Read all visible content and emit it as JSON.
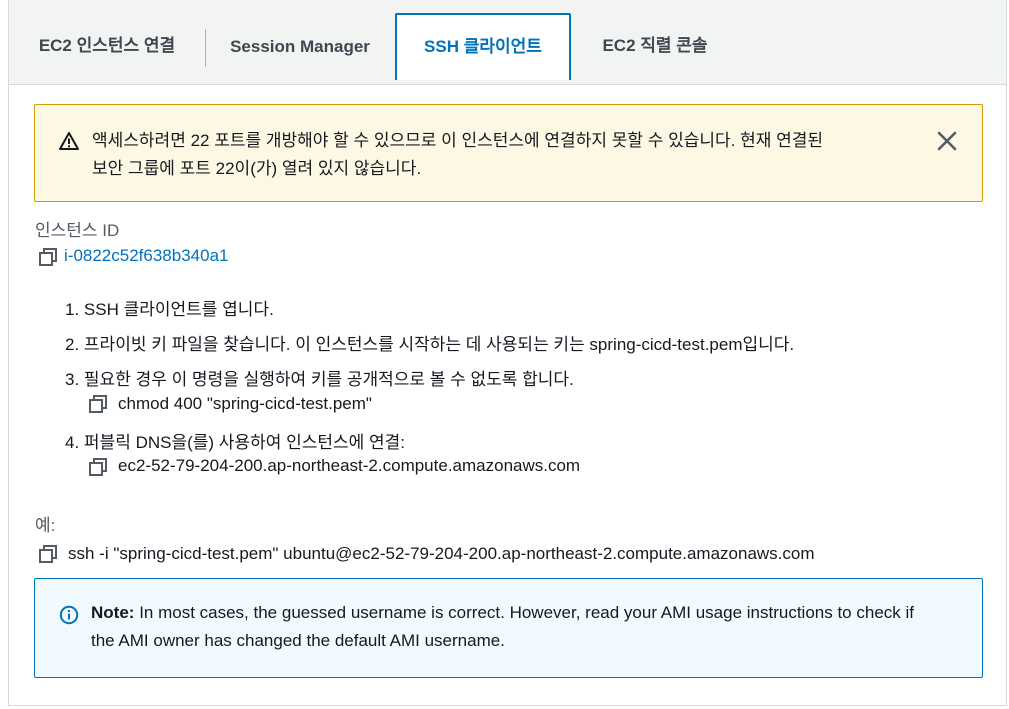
{
  "tabs": [
    {
      "label": "EC2 인스턴스 연결"
    },
    {
      "label": "Session Manager"
    },
    {
      "label": "SSH 클라이언트"
    },
    {
      "label": "EC2 직렬 콘솔"
    }
  ],
  "active_tab": "SSH 클라이언트",
  "warning": {
    "line1": "액세스하려면 22 포트를 개방해야 할 수 있으므로 이 인스턴스에 연결하지 못할 수 있습니다. 현재 연결된",
    "line2": "보안 그룹에 포트 22이(가) 열려 있지 않습니다."
  },
  "instance": {
    "label": "인스턴스 ID",
    "id": "i-0822c52f638b340a1"
  },
  "steps": [
    {
      "num": "1.",
      "text": "SSH 클라이언트를 엽니다."
    },
    {
      "num": "2.",
      "text": "프라이빗 키 파일을 찾습니다. 이 인스턴스를 시작하는 데 사용되는 키는 spring-cicd-test.pem입니다."
    },
    {
      "num": "3.",
      "text": "필요한 경우 이 명령을 실행하여 키를 공개적으로 볼 수 없도록 합니다."
    },
    {
      "num": "4.",
      "text": "퍼블릭 DNS을(를) 사용하여 인스턴스에 연결:"
    }
  ],
  "commands": {
    "chmod": "chmod 400 \"spring-cicd-test.pem\"",
    "dns": "ec2-52-79-204-200.ap-northeast-2.compute.amazonaws.com"
  },
  "example": {
    "label": "예:",
    "command": "ssh -i \"spring-cicd-test.pem\" ubuntu@ec2-52-79-204-200.ap-northeast-2.compute.amazonaws.com"
  },
  "info": {
    "note_label": "Note:",
    "line1": "In most cases, the guessed username is correct. However, read your AMI usage instructions to check if",
    "line2": "the AMI owner has changed the default AMI username."
  },
  "colors": {
    "accent": "#0073bb",
    "warning_border": "#d59b00",
    "warning_bg": "#fdf8e4",
    "info_bg": "#f1faff"
  }
}
